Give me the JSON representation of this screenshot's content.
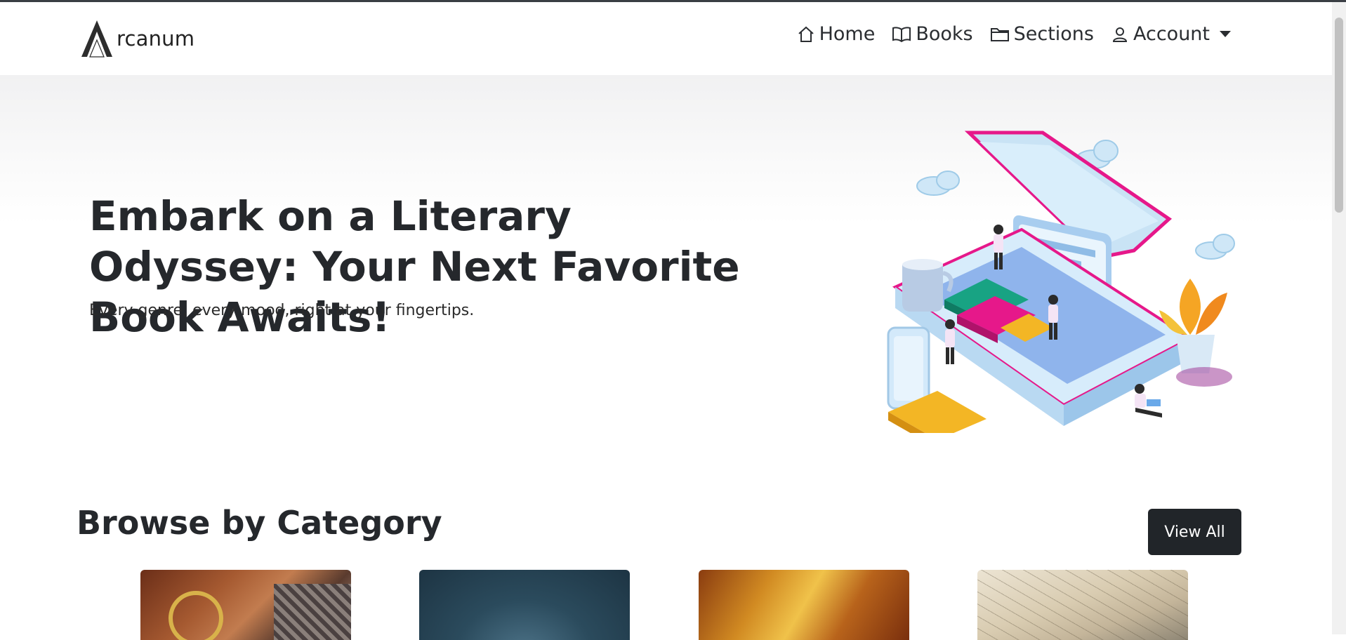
{
  "brand": {
    "name": "rcanum"
  },
  "nav": {
    "home": "Home",
    "books": "Books",
    "sections": "Sections",
    "account": "Account"
  },
  "hero": {
    "title": "Embark on a Literary Odyssey: Your Next Favorite Book Awaits!",
    "subtitle": "Every genre, every mood, right at your fingertips."
  },
  "categories": {
    "title": "Browse by Category",
    "view_all": "View All"
  },
  "colors": {
    "button_dark": "#212529",
    "accent_pink": "#e6188a",
    "accent_teal": "#18a383"
  }
}
